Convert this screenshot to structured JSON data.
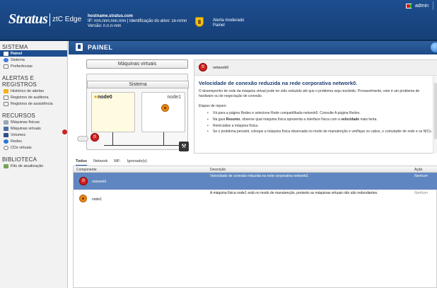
{
  "header": {
    "logo": "Stratus",
    "logo_sub": "ztC Edge",
    "hostname": "hostname.stratus.com",
    "host_details": "IP: nnn.nnn.nnn.nnn | Identificação do ativo: ze-nnnn",
    "version": "Versão: n.n.n-nnn",
    "alert_line1": "Alerta moderado",
    "alert_line2": "Painel",
    "user": "admin",
    "colors": {
      "header": "#1d4e8f",
      "accent": "#f2c21b"
    }
  },
  "sidebar": {
    "system_title": "SISTEMA",
    "system_items": [
      {
        "label": "Painel",
        "icon": "dashboard-icon",
        "active": true
      },
      {
        "label": "Sistema",
        "icon": "globe-icon"
      },
      {
        "label": "Preferências",
        "icon": "preferences-icon"
      }
    ],
    "alerts_title": "ALERTAS E REGISTROS",
    "alerts_items": [
      {
        "label": "Histórico de alertas",
        "icon": "warning-icon"
      },
      {
        "label": "Registros de auditoria",
        "icon": "document-icon"
      },
      {
        "label": "Registros de assistência",
        "icon": "document-icon"
      }
    ],
    "resources_title": "RECURSOS",
    "resources_items": [
      {
        "label": "Máquinas físicas",
        "icon": "server-icon"
      },
      {
        "label": "Máquinas virtuais",
        "icon": "vm-icon"
      },
      {
        "label": "Volumes",
        "icon": "volume-icon"
      },
      {
        "label": "Redes",
        "icon": "network-icon"
      },
      {
        "label": "CDs virtuais",
        "icon": "cd-icon"
      }
    ],
    "library_title": "BIBLIOTECA",
    "library_items": [
      {
        "label": "Kits de atualização",
        "icon": "kit-icon"
      }
    ]
  },
  "panel": {
    "title": "PAINEL"
  },
  "diagram": {
    "vm_label": "Máquinas virtuais",
    "system_label": "Sistema",
    "node0": "node0",
    "node1": "node1",
    "net_badge": "!!"
  },
  "detail": {
    "name": "network0",
    "title": "Velocidade de conexão reduzida na rede corporativa network0.",
    "desc": "O desempenho de rede da máquina virtual pode ter sido reduzido até que o problema seja resolvido. Provavelmente, este é um problema de hardware ou de negociação de conexão.",
    "steps_title": "Etapas de reparo:",
    "step1": "Vá para a página Redes e selecione Rede compartilhada network0. Consulte A página Redes.",
    "step2_a": "Na guia ",
    "step2_b": "Resumo",
    "step2_c": ", observe qual máquina física apresenta a interface física com a ",
    "step2_d": "velocidade",
    "step2_e": " mais lenta.",
    "step3": "Reinicialize a máquina física.",
    "step4": "Se o problema persistir, coloque a máquina física observada no modo de manutenção e verifique os cabos, o comutador de rede e os NICs."
  },
  "tabs": [
    "Todos",
    "Network",
    "MF:",
    "Ignorado(s)"
  ],
  "table": {
    "headers": [
      "Componente",
      "Descrição",
      "Ação"
    ],
    "rows": [
      {
        "component": "network0",
        "description": "Velocidade de conexão reduzida na rede corporativa network0.",
        "action": "Nenhum",
        "badge": "!!"
      },
      {
        "component": "node1",
        "description": "A máquina física node1 está no modo de manutenção, portanto as máquinas virtuais não são redundantes.",
        "action": "Nenhum"
      }
    ]
  }
}
